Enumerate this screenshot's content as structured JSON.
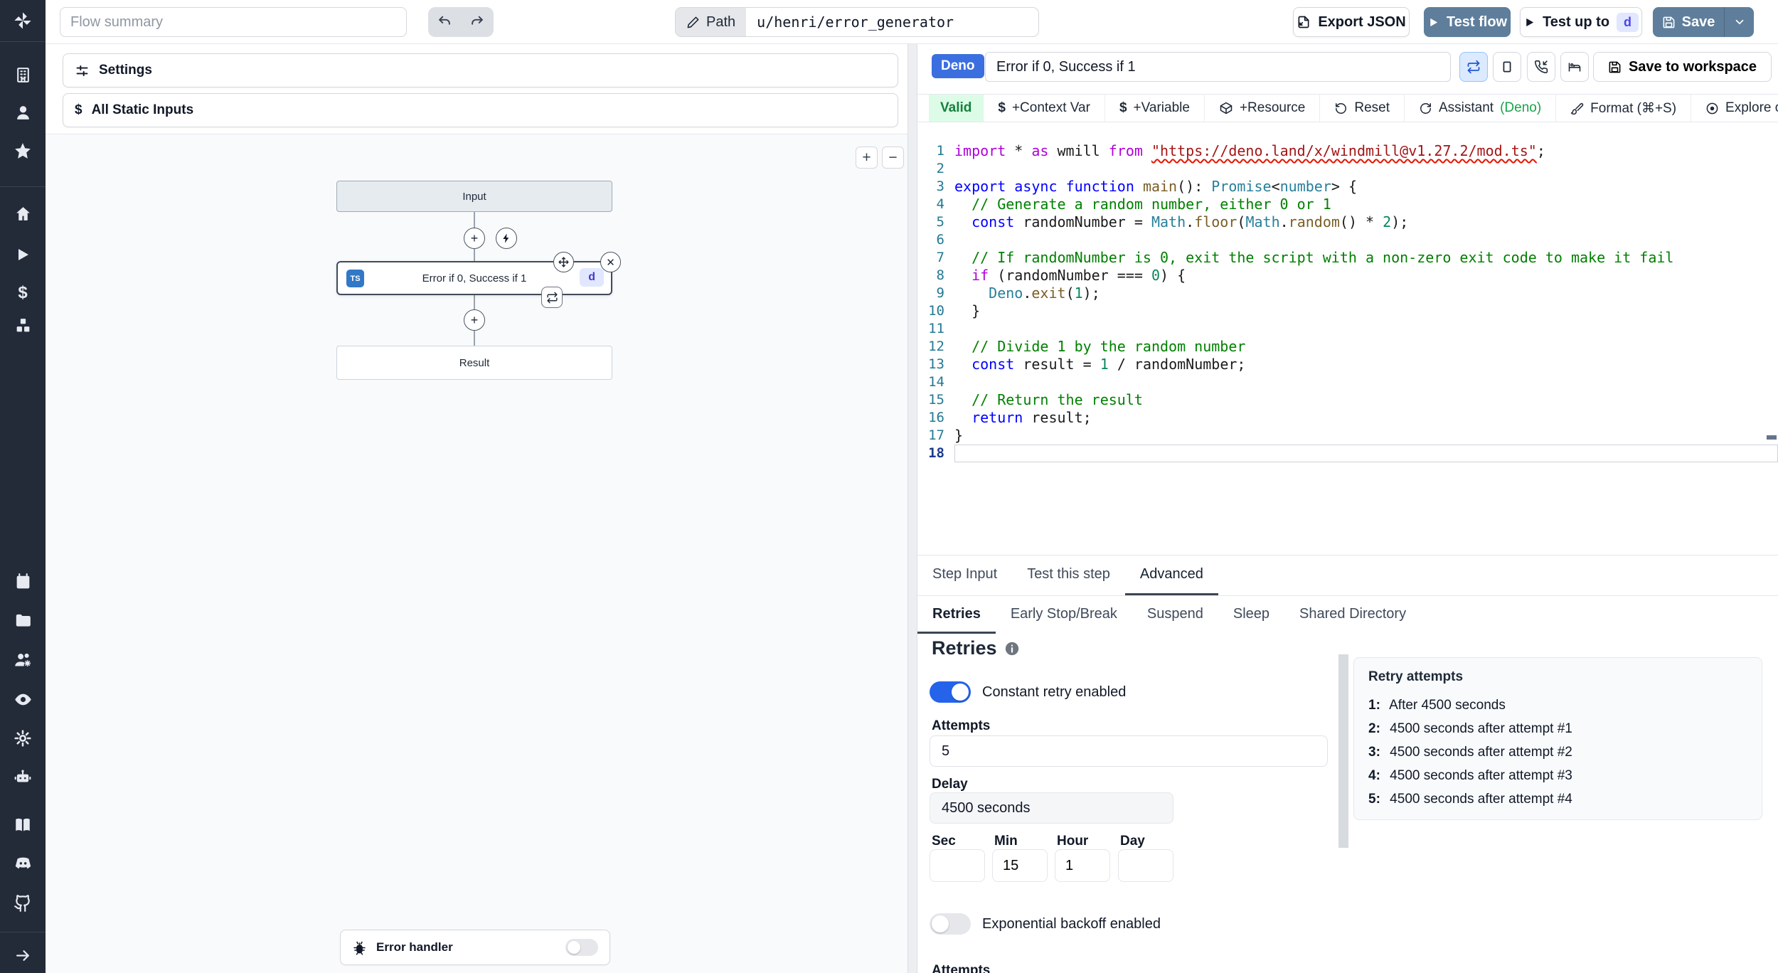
{
  "colors": {
    "sidebar_bg": "#232a38",
    "steel_blue_button": "#5e7e9c",
    "accent_blue": "#3b6fe0",
    "toggle_on_blue": "#2563eb",
    "valid_green_bg": "#dcfce7",
    "valid_green_text": "#15803d",
    "deno_green": "#16a34a",
    "ts_badge_blue": "#3178c6",
    "d_badge_bg": "#e0e7ff",
    "d_badge_text": "#4f46e5",
    "canvas_bg": "#f8fafc"
  },
  "icons": {
    "dollar": "$",
    "plus": "+",
    "minus": "−",
    "close": "✕"
  },
  "topbar": {
    "flow_summary_placeholder": "Flow summary",
    "path_label": "Path",
    "path_value": "u/henri/error_generator",
    "export_json_label": "Export JSON",
    "test_flow_label": "Test flow",
    "test_up_to_label": "Test up to",
    "test_up_to_badge": "d",
    "save_label": "Save"
  },
  "left_panel": {
    "settings_label": "Settings",
    "static_inputs_label": "All Static Inputs",
    "graph": {
      "input_node": "Input",
      "step_node": {
        "lang_badge": "TS",
        "label": "Error if 0, Success if 1",
        "suffix_badge": "d"
      },
      "result_node": "Result",
      "error_handler_label": "Error handler"
    }
  },
  "right_panel": {
    "lang_badge": "Deno",
    "step_name": "Error if 0, Success if 1",
    "save_to_workspace_label": "Save to workspace",
    "toolbar": {
      "valid": "Valid",
      "context_var": "+Context Var",
      "variable": "+Variable",
      "resource": "+Resource",
      "reset": "Reset",
      "assistant": "Assistant",
      "assistant_lang": "(Deno)",
      "format": "Format (⌘+S)",
      "explore": "Explore other s"
    },
    "tabs": {
      "step_input": "Step Input",
      "test_this_step": "Test this step",
      "advanced": "Advanced"
    },
    "subtabs": {
      "retries": "Retries",
      "early_stop": "Early Stop/Break",
      "suspend": "Suspend",
      "sleep": "Sleep",
      "shared_directory": "Shared Directory"
    },
    "retries": {
      "heading": "Retries",
      "constant_toggle_label": "Constant retry enabled",
      "attempts_label": "Attempts",
      "attempts_value": "5",
      "delay_label": "Delay",
      "delay_value": "4500 seconds",
      "sec_label": "Sec",
      "min_label": "Min",
      "hour_label": "Hour",
      "day_label": "Day",
      "sec_value": "",
      "min_value": "15",
      "hour_value": "1",
      "day_value": "",
      "exponential_toggle_label": "Exponential backoff enabled",
      "cutoff_label": "Attempts",
      "retry_attempts": {
        "title": "Retry attempts",
        "rows": [
          {
            "n": "1:",
            "text": "After 4500 seconds"
          },
          {
            "n": "2:",
            "text": "4500 seconds after attempt #1"
          },
          {
            "n": "3:",
            "text": "4500 seconds after attempt #2"
          },
          {
            "n": "4:",
            "text": "4500 seconds after attempt #3"
          },
          {
            "n": "5:",
            "text": "4500 seconds after attempt #4"
          }
        ]
      }
    }
  },
  "editor": {
    "active_line": 18,
    "lines": [
      [
        [
          "m",
          "import"
        ],
        [
          "p",
          " * "
        ],
        [
          "m",
          "as"
        ],
        [
          "p",
          " wmill "
        ],
        [
          "m",
          "from"
        ],
        [
          "p",
          " "
        ],
        [
          "su",
          "\"https://deno.land/x/windmill@v1.27.2/mod.ts\""
        ],
        [
          "p",
          ";"
        ]
      ],
      [],
      [
        [
          "k",
          "export"
        ],
        [
          "p",
          " "
        ],
        [
          "k",
          "async"
        ],
        [
          "p",
          " "
        ],
        [
          "k",
          "function"
        ],
        [
          "p",
          " "
        ],
        [
          "f",
          "main"
        ],
        [
          "p",
          "(): "
        ],
        [
          "t",
          "Promise"
        ],
        [
          "p",
          "<"
        ],
        [
          "t",
          "number"
        ],
        [
          "p",
          "> {"
        ]
      ],
      [
        [
          "c",
          "  // Generate a random number, either 0 or 1"
        ]
      ],
      [
        [
          "p",
          "  "
        ],
        [
          "k",
          "const"
        ],
        [
          "p",
          " randomNumber = "
        ],
        [
          "t",
          "Math"
        ],
        [
          "p",
          "."
        ],
        [
          "f",
          "floor"
        ],
        [
          "p",
          "("
        ],
        [
          "t",
          "Math"
        ],
        [
          "p",
          "."
        ],
        [
          "f",
          "random"
        ],
        [
          "p",
          "() * "
        ],
        [
          "n",
          "2"
        ],
        [
          "p",
          ");"
        ]
      ],
      [],
      [
        [
          "c",
          "  // If randomNumber is 0, exit the script with a non-zero exit code to make it fail"
        ]
      ],
      [
        [
          "p",
          "  "
        ],
        [
          "m",
          "if"
        ],
        [
          "p",
          " (randomNumber === "
        ],
        [
          "n",
          "0"
        ],
        [
          "p",
          ") {"
        ]
      ],
      [
        [
          "p",
          "    "
        ],
        [
          "t",
          "Deno"
        ],
        [
          "p",
          "."
        ],
        [
          "f",
          "exit"
        ],
        [
          "p",
          "("
        ],
        [
          "n",
          "1"
        ],
        [
          "p",
          ");"
        ]
      ],
      [
        [
          "p",
          "  }"
        ]
      ],
      [],
      [
        [
          "c",
          "  // Divide 1 by the random number"
        ]
      ],
      [
        [
          "p",
          "  "
        ],
        [
          "k",
          "const"
        ],
        [
          "p",
          " result = "
        ],
        [
          "n",
          "1"
        ],
        [
          "p",
          " / randomNumber;"
        ]
      ],
      [],
      [
        [
          "c",
          "  // Return the result"
        ]
      ],
      [
        [
          "p",
          "  "
        ],
        [
          "k",
          "return"
        ],
        [
          "p",
          " result;"
        ]
      ],
      [
        [
          "p",
          "}"
        ]
      ],
      []
    ]
  }
}
